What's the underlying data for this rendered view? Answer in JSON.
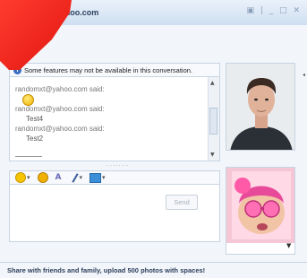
{
  "window": {
    "title": "…@yahoo.com",
    "controls": "▣ | _ □ ✕"
  },
  "notice": {
    "text": "Some features may not be available in this conversation."
  },
  "conversation": {
    "messages": [
      {
        "sender": "randomxt@yahoo.com said:",
        "body": "",
        "emoticon": "smiley-icon"
      },
      {
        "sender": "randomxt@yahoo.com said:",
        "body": "Test4"
      },
      {
        "sender": "randomxt@yahoo.com said:",
        "body": "Test2"
      }
    ]
  },
  "toolbar": {
    "items": [
      "emoticons",
      "audibles",
      "font",
      "pen",
      "photos"
    ]
  },
  "composer": {
    "value": "",
    "send_label": "Send"
  },
  "promo": {
    "text": "Share with friends and family, upload 500 photos with spaces!"
  },
  "colors": {
    "accent": "#3b6fc4",
    "arrow": "#e01610"
  }
}
